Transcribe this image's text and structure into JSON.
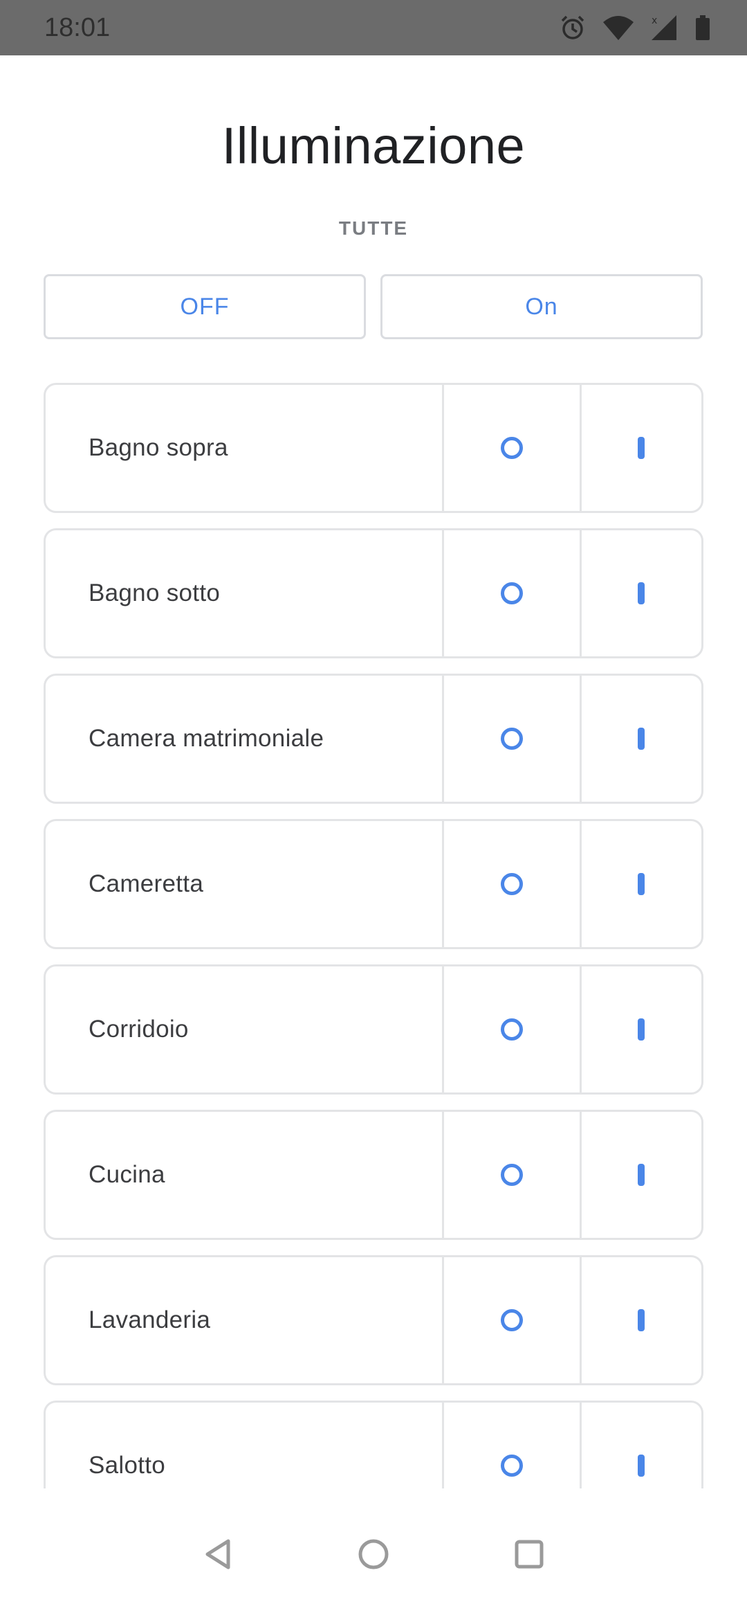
{
  "status_bar": {
    "time": "18:01",
    "icons": [
      "alarm-icon",
      "wifi-icon",
      "signal-icon",
      "battery-icon"
    ]
  },
  "page": {
    "title": "Illuminazione",
    "section_label": "TUTTE"
  },
  "all_controls": {
    "off_label": "OFF",
    "on_label": "On"
  },
  "rooms": [
    {
      "name": "Bagno sopra"
    },
    {
      "name": "Bagno sotto"
    },
    {
      "name": "Camera matrimoniale"
    },
    {
      "name": "Cameretta"
    },
    {
      "name": "Corridoio"
    },
    {
      "name": "Cucina"
    },
    {
      "name": "Lavanderia"
    },
    {
      "name": "Salotto"
    }
  ],
  "room_controls": {
    "off_icon": "power-off-icon",
    "on_icon": "power-on-icon"
  },
  "nav_bar": {
    "icons": [
      "back-icon",
      "home-icon",
      "recents-icon"
    ]
  },
  "colors": {
    "accent": "#4a86e8",
    "status_bar": "#6b6b6b",
    "border": "#e3e4e6"
  }
}
